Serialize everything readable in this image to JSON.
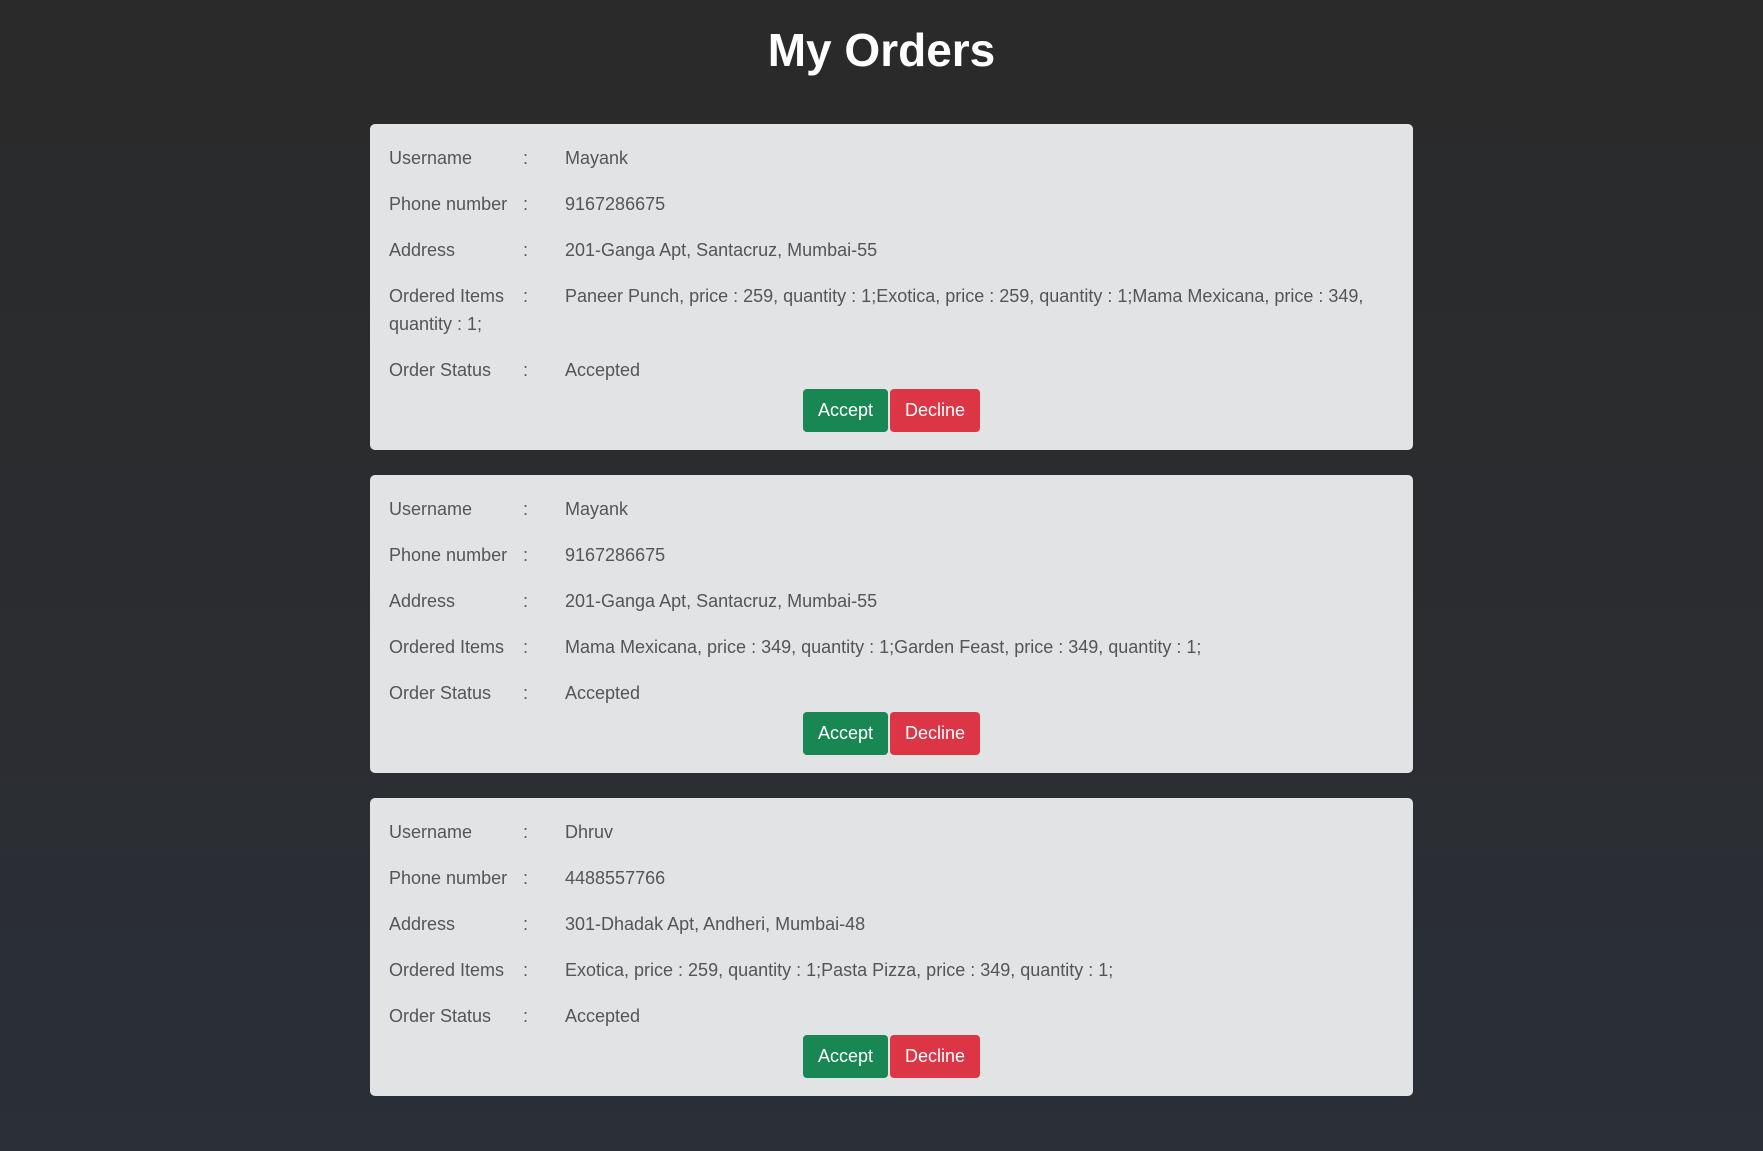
{
  "page": {
    "title": "My Orders"
  },
  "labels": {
    "username": "Username",
    "phone": "Phone number",
    "address": "Address",
    "items": "Ordered Items",
    "status": "Order Status",
    "separator": ":"
  },
  "buttons": {
    "accept": "Accept",
    "decline": "Decline"
  },
  "colors": {
    "accept": "#198754",
    "decline": "#dc3545",
    "card": "#e2e3e5"
  },
  "orders": [
    {
      "username": "Mayank",
      "phone": "9167286675",
      "address": "201-Ganga Apt, Santacruz, Mumbai-55",
      "items": "Paneer Punch, price : 259, quantity : 1;Exotica, price : 259, quantity : 1;Mama Mexicana, price : 349, quantity : 1;",
      "status": "Accepted"
    },
    {
      "username": "Mayank",
      "phone": "9167286675",
      "address": "201-Ganga Apt, Santacruz, Mumbai-55",
      "items": "Mama Mexicana, price : 349, quantity : 1;Garden Feast, price : 349, quantity : 1;",
      "status": "Accepted"
    },
    {
      "username": "Dhruv",
      "phone": "4488557766",
      "address": "301-Dhadak Apt, Andheri, Mumbai-48",
      "items": "Exotica, price : 259, quantity : 1;Pasta Pizza, price : 349, quantity : 1;",
      "status": "Accepted"
    }
  ]
}
